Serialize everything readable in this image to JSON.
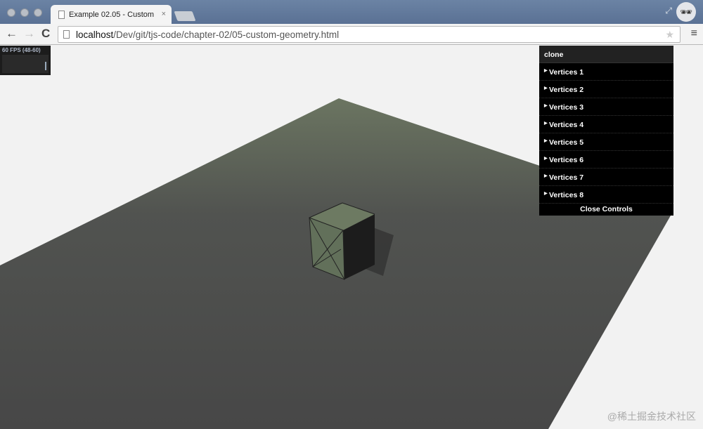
{
  "browser": {
    "tab_title": "Example 02.05 - Custom",
    "tab_close": "×",
    "url_host": "localhost",
    "url_path": "/Dev/git/tjs-code/chapter-02/05-custom-geometry.html",
    "back": "←",
    "forward": "→",
    "reload": "C",
    "menu": "≡",
    "star": "★"
  },
  "stats": {
    "fps_text": "60 FPS (48-60)"
  },
  "gui": {
    "clone_label": "clone",
    "folders": [
      {
        "label": "Vertices 1"
      },
      {
        "label": "Vertices 2"
      },
      {
        "label": "Vertices 3"
      },
      {
        "label": "Vertices 4"
      },
      {
        "label": "Vertices 5"
      },
      {
        "label": "Vertices 6"
      },
      {
        "label": "Vertices 7"
      },
      {
        "label": "Vertices 8"
      }
    ],
    "close_label": "Close Controls"
  },
  "watermark": "@稀土掘金技术社区",
  "colors": {
    "plane": "#4d4d4d",
    "cube": "#7d8f6c",
    "background": "#f2f2f2",
    "gui": "#000000"
  }
}
